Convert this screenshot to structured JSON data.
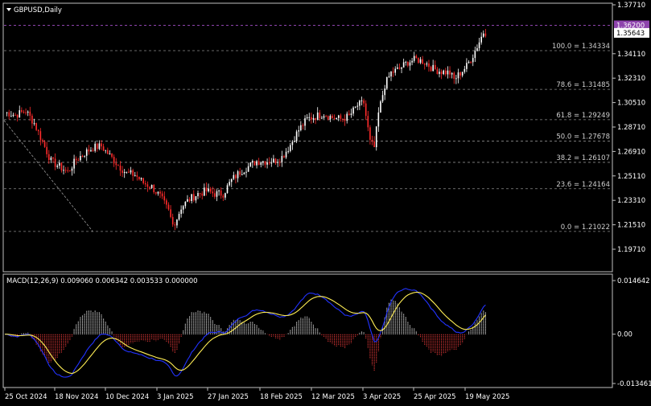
{
  "symbol_label": "GBPUSD,Daily",
  "macd_label": "MACD(12,26,9) 0.009060 0.006342 0.003533 0.000000",
  "colors": {
    "background": "#000000",
    "foreground": "#ffffff",
    "grid": "#8a8a8a",
    "bull_candle": "#ffffff",
    "bear_candle": "#ff2b2b",
    "macd_line": "#2233ff",
    "signal_line": "#ffee55",
    "hist_positive": "#dddddd",
    "hist_negative": "#e83a3a",
    "high_line": "#8e44ad",
    "high_label_bg": "#8e44ad"
  },
  "chart_data": [
    {
      "type": "candlestick",
      "title": "GBPUSD,Daily",
      "ylim": [
        1.1971,
        1.3771
      ],
      "y_ticks": [
        "1.37710",
        "1.34110",
        "1.32310",
        "1.30510",
        "1.28710",
        "1.26910",
        "1.25110",
        "1.23310",
        "1.21510",
        "1.19710"
      ],
      "x_ticks": [
        "25 Oct 2024",
        "18 Nov 2024",
        "10 Dec 2024",
        "3 Jan 2025",
        "27 Jan 2025",
        "18 Feb 2025",
        "12 Mar 2025",
        "3 Apr 2025",
        "25 Apr 2025",
        "19 May 2025"
      ],
      "price_labels": {
        "high_marker": "1.36200",
        "current_price": "1.35643"
      },
      "fibonacci_levels": [
        {
          "label": "100.0 = 1.34334",
          "value": 1.34334
        },
        {
          "label": "78.6 = 1.31485",
          "value": 1.31485
        },
        {
          "label": "61.8 = 1.29249",
          "value": 1.29249
        },
        {
          "label": "50.0 = 1.27678",
          "value": 1.27678
        },
        {
          "label": "38.2 = 1.26107",
          "value": 1.26107
        },
        {
          "label": "23.6 = 1.24164",
          "value": 1.24164
        },
        {
          "label": "0.0 = 1.21022",
          "value": 1.21022
        }
      ],
      "close_path": [
        [
          0,
          1.298
        ],
        [
          5,
          1.296
        ],
        [
          10,
          1.299
        ],
        [
          14,
          1.29
        ],
        [
          18,
          1.276
        ],
        [
          22,
          1.262
        ],
        [
          26,
          1.258
        ],
        [
          30,
          1.254
        ],
        [
          34,
          1.263
        ],
        [
          38,
          1.268
        ],
        [
          42,
          1.272
        ],
        [
          46,
          1.273
        ],
        [
          50,
          1.266
        ],
        [
          54,
          1.259
        ],
        [
          58,
          1.253
        ],
        [
          62,
          1.252
        ],
        [
          66,
          1.246
        ],
        [
          70,
          1.243
        ],
        [
          74,
          1.236
        ],
        [
          78,
          1.225
        ],
        [
          80,
          1.215
        ],
        [
          82,
          1.22
        ],
        [
          84,
          1.228
        ],
        [
          88,
          1.234
        ],
        [
          92,
          1.238
        ],
        [
          96,
          1.24
        ],
        [
          100,
          1.238
        ],
        [
          104,
          1.238
        ],
        [
          108,
          1.248
        ],
        [
          112,
          1.254
        ],
        [
          116,
          1.258
        ],
        [
          120,
          1.262
        ],
        [
          124,
          1.262
        ],
        [
          128,
          1.262
        ],
        [
          132,
          1.265
        ],
        [
          136,
          1.274
        ],
        [
          140,
          1.285
        ],
        [
          144,
          1.293
        ],
        [
          148,
          1.295
        ],
        [
          152,
          1.297
        ],
        [
          156,
          1.294
        ],
        [
          160,
          1.293
        ],
        [
          164,
          1.295
        ],
        [
          168,
          1.303
        ],
        [
          171,
          1.305
        ],
        [
          174,
          1.276
        ],
        [
          176,
          1.272
        ],
        [
          178,
          1.297
        ],
        [
          181,
          1.318
        ],
        [
          184,
          1.327
        ],
        [
          188,
          1.33
        ],
        [
          192,
          1.335
        ],
        [
          196,
          1.337
        ],
        [
          200,
          1.335
        ],
        [
          204,
          1.33
        ],
        [
          208,
          1.328
        ],
        [
          212,
          1.327
        ],
        [
          214,
          1.322
        ],
        [
          217,
          1.327
        ],
        [
          220,
          1.332
        ],
        [
          223,
          1.34
        ],
        [
          226,
          1.35
        ],
        [
          228,
          1.357
        ]
      ],
      "x_domain": [
        0,
        230
      ]
    },
    {
      "type": "macd",
      "title": "MACD(12,26,9) 0.009060 0.006342 0.003533 0.000000",
      "ylim": [
        -0.013461,
        0.014642
      ],
      "y_ticks": [
        "0.014642",
        "0.00",
        "-0.013461"
      ]
    }
  ]
}
